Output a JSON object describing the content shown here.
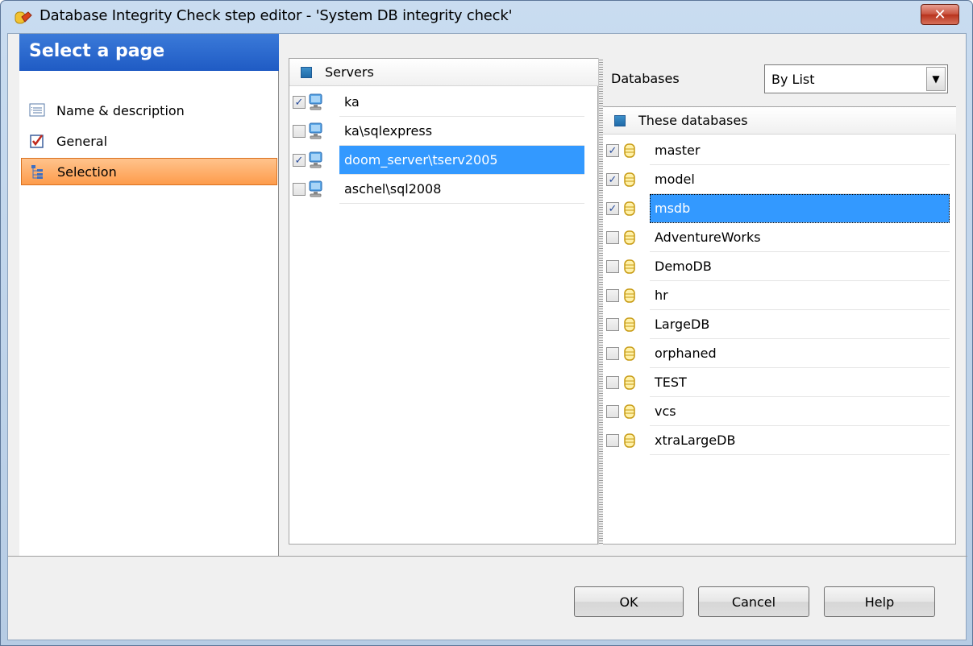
{
  "window": {
    "title": "Database Integrity Check step editor - 'System DB integrity check'",
    "close_glyph": "✕"
  },
  "nav": {
    "header": "Select a page",
    "items": [
      {
        "label": "Name & description",
        "icon": "list-icon",
        "selected": false
      },
      {
        "label": "General",
        "icon": "checkbox-icon",
        "selected": false
      },
      {
        "label": "Selection",
        "icon": "tree-icon",
        "selected": true
      }
    ]
  },
  "servers": {
    "header": "Servers",
    "rows": [
      {
        "name": "ka",
        "checked": true,
        "selected": false
      },
      {
        "name": "ka\\sqlexpress",
        "checked": false,
        "selected": false
      },
      {
        "name": "doom_server\\tserv2005",
        "checked": true,
        "selected": true
      },
      {
        "name": "aschel\\sql2008",
        "checked": false,
        "selected": false
      }
    ]
  },
  "databases": {
    "label": "Databases",
    "mode": "By List",
    "header": "These databases",
    "rows": [
      {
        "name": "master",
        "checked": true,
        "selected": false
      },
      {
        "name": "model",
        "checked": true,
        "selected": false
      },
      {
        "name": "msdb",
        "checked": true,
        "selected": true
      },
      {
        "name": "AdventureWorks",
        "checked": false,
        "selected": false
      },
      {
        "name": "DemoDB",
        "checked": false,
        "selected": false
      },
      {
        "name": "hr",
        "checked": false,
        "selected": false
      },
      {
        "name": "LargeDB",
        "checked": false,
        "selected": false
      },
      {
        "name": "orphaned",
        "checked": false,
        "selected": false
      },
      {
        "name": "TEST",
        "checked": false,
        "selected": false
      },
      {
        "name": "vcs",
        "checked": false,
        "selected": false
      },
      {
        "name": "xtraLargeDB",
        "checked": false,
        "selected": false
      }
    ]
  },
  "buttons": {
    "ok": "OK",
    "cancel": "Cancel",
    "help": "Help"
  }
}
